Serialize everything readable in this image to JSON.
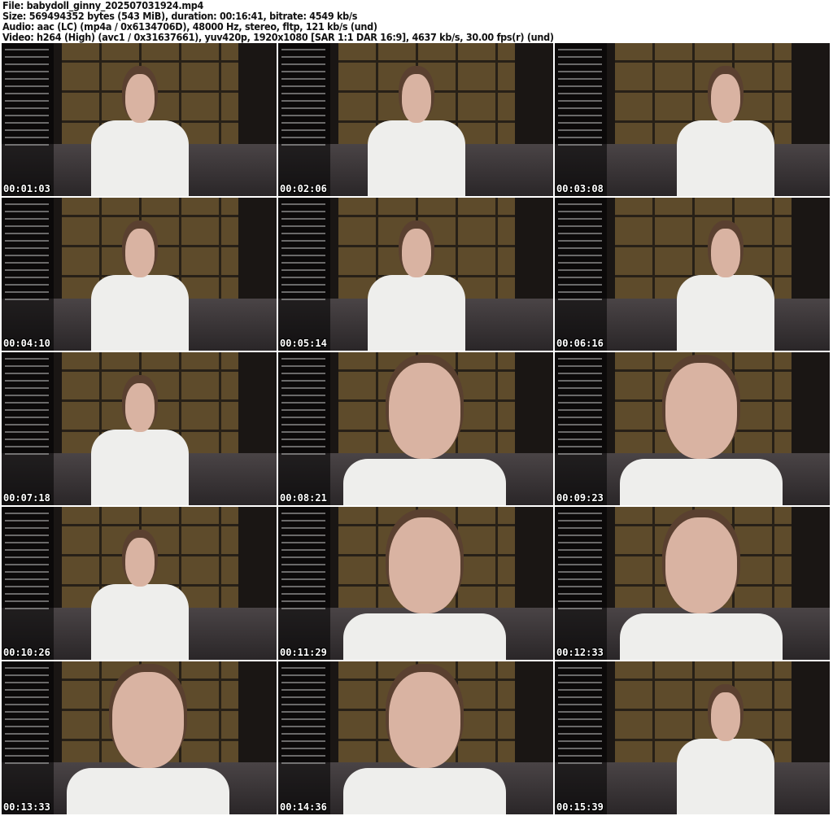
{
  "header": {
    "file": "File: babydoll_ginny_202507031924.mp4",
    "size": "Size: 569494352 bytes (543 MiB), duration: 00:16:41, bitrate: 4549 kb/s",
    "audio": "Audio: aac (LC) (mp4a / 0x6134706D), 48000 Hz, stereo, fltp, 121 kb/s (und)",
    "video": "Video: h264 (High) (avc1 / 0x31637661), yuv420p, 1920x1080 [SAR 1:1 DAR 16:9], 4637 kb/s, 30.00 fps(r) (und)"
  },
  "thumbnails": [
    {
      "timestamp": "00:01:03",
      "shot": "wide"
    },
    {
      "timestamp": "00:02:06",
      "shot": "wide"
    },
    {
      "timestamp": "00:03:08",
      "shot": "wide"
    },
    {
      "timestamp": "00:04:10",
      "shot": "wide"
    },
    {
      "timestamp": "00:05:14",
      "shot": "wide"
    },
    {
      "timestamp": "00:06:16",
      "shot": "wide"
    },
    {
      "timestamp": "00:07:18",
      "shot": "wide"
    },
    {
      "timestamp": "00:08:21",
      "shot": "close"
    },
    {
      "timestamp": "00:09:23",
      "shot": "close"
    },
    {
      "timestamp": "00:10:26",
      "shot": "wide"
    },
    {
      "timestamp": "00:11:29",
      "shot": "close"
    },
    {
      "timestamp": "00:12:33",
      "shot": "close"
    },
    {
      "timestamp": "00:13:33",
      "shot": "close"
    },
    {
      "timestamp": "00:14:36",
      "shot": "close"
    },
    {
      "timestamp": "00:15:39",
      "shot": "wide"
    }
  ]
}
